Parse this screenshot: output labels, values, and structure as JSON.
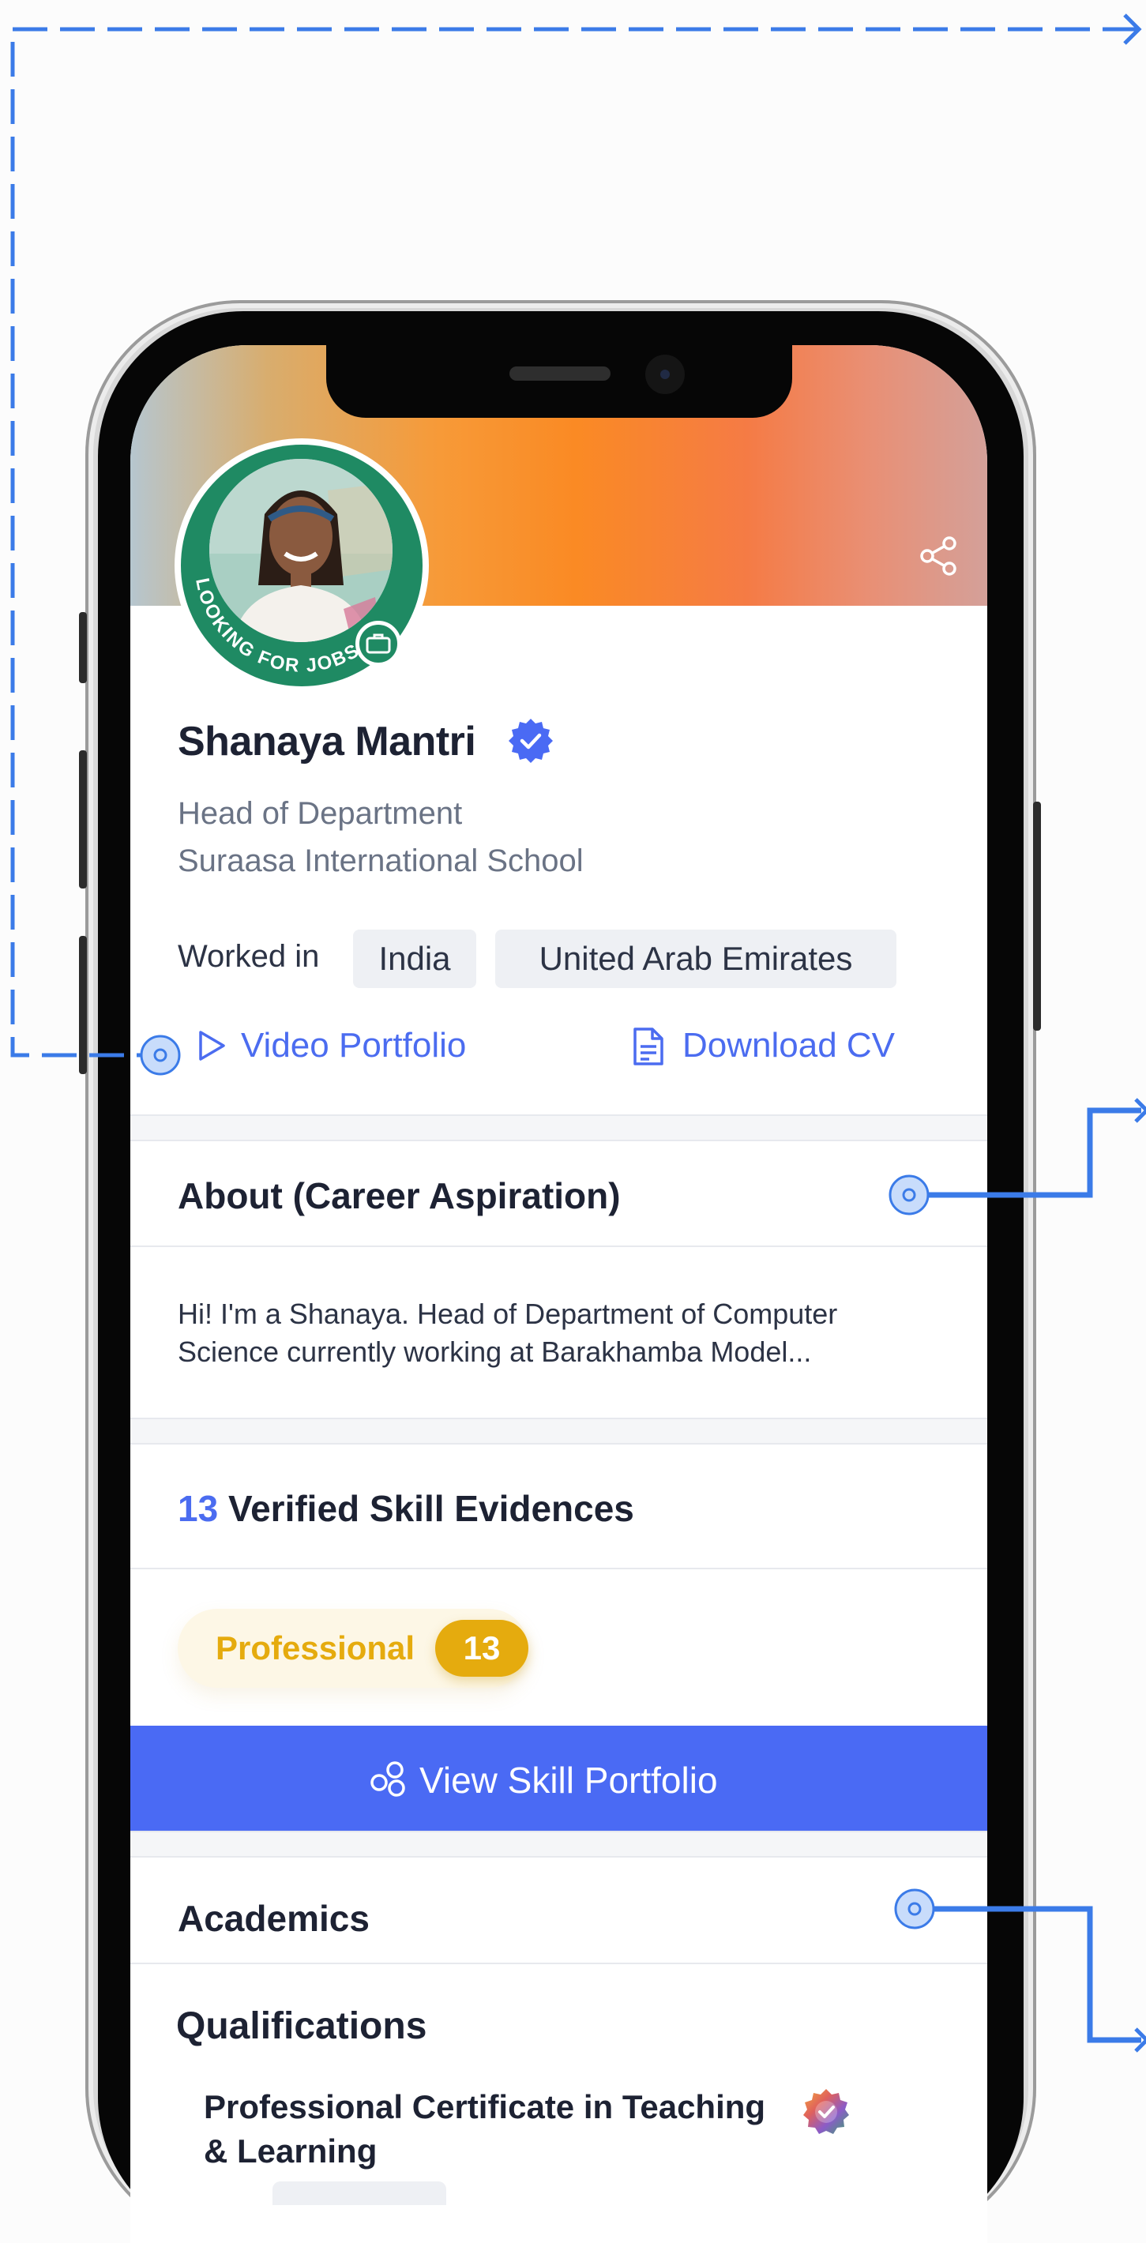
{
  "profile": {
    "name": "Shanaya Mantri",
    "role": "Head of Department",
    "school": "Suraasa International School",
    "status_ring": "LOOKING FOR JOBS",
    "worked_in_label": "Worked in",
    "countries": [
      "India",
      "United Arab Emirates"
    ]
  },
  "actions": {
    "video_portfolio": "Video Portfolio",
    "download_cv": "Download CV"
  },
  "about": {
    "title": "About (Career Aspiration)",
    "text": "Hi! I'm a Shanaya. Head of Department of Computer Science currently working at Barakhamba Model..."
  },
  "skills": {
    "count": "13",
    "title": "Verified Skill Evidences",
    "pill_label": "Professional",
    "pill_count": "13",
    "cta": "View Skill Portfolio"
  },
  "academics": {
    "title": "Academics",
    "qualifications_title": "Qualifications",
    "qualification_item": "Professional Certificate in Teaching & Learning"
  },
  "theme": {
    "accent": "#4A6AF4",
    "pill_gold": "#E5AB0E",
    "status_green": "#1F8A63",
    "connector_blue": "#3B7BE8"
  },
  "icons": [
    "share-icon",
    "verified-badge-icon",
    "briefcase-icon",
    "play-icon",
    "document-icon",
    "skill-nodes-icon",
    "certificate-badge-icon"
  ]
}
